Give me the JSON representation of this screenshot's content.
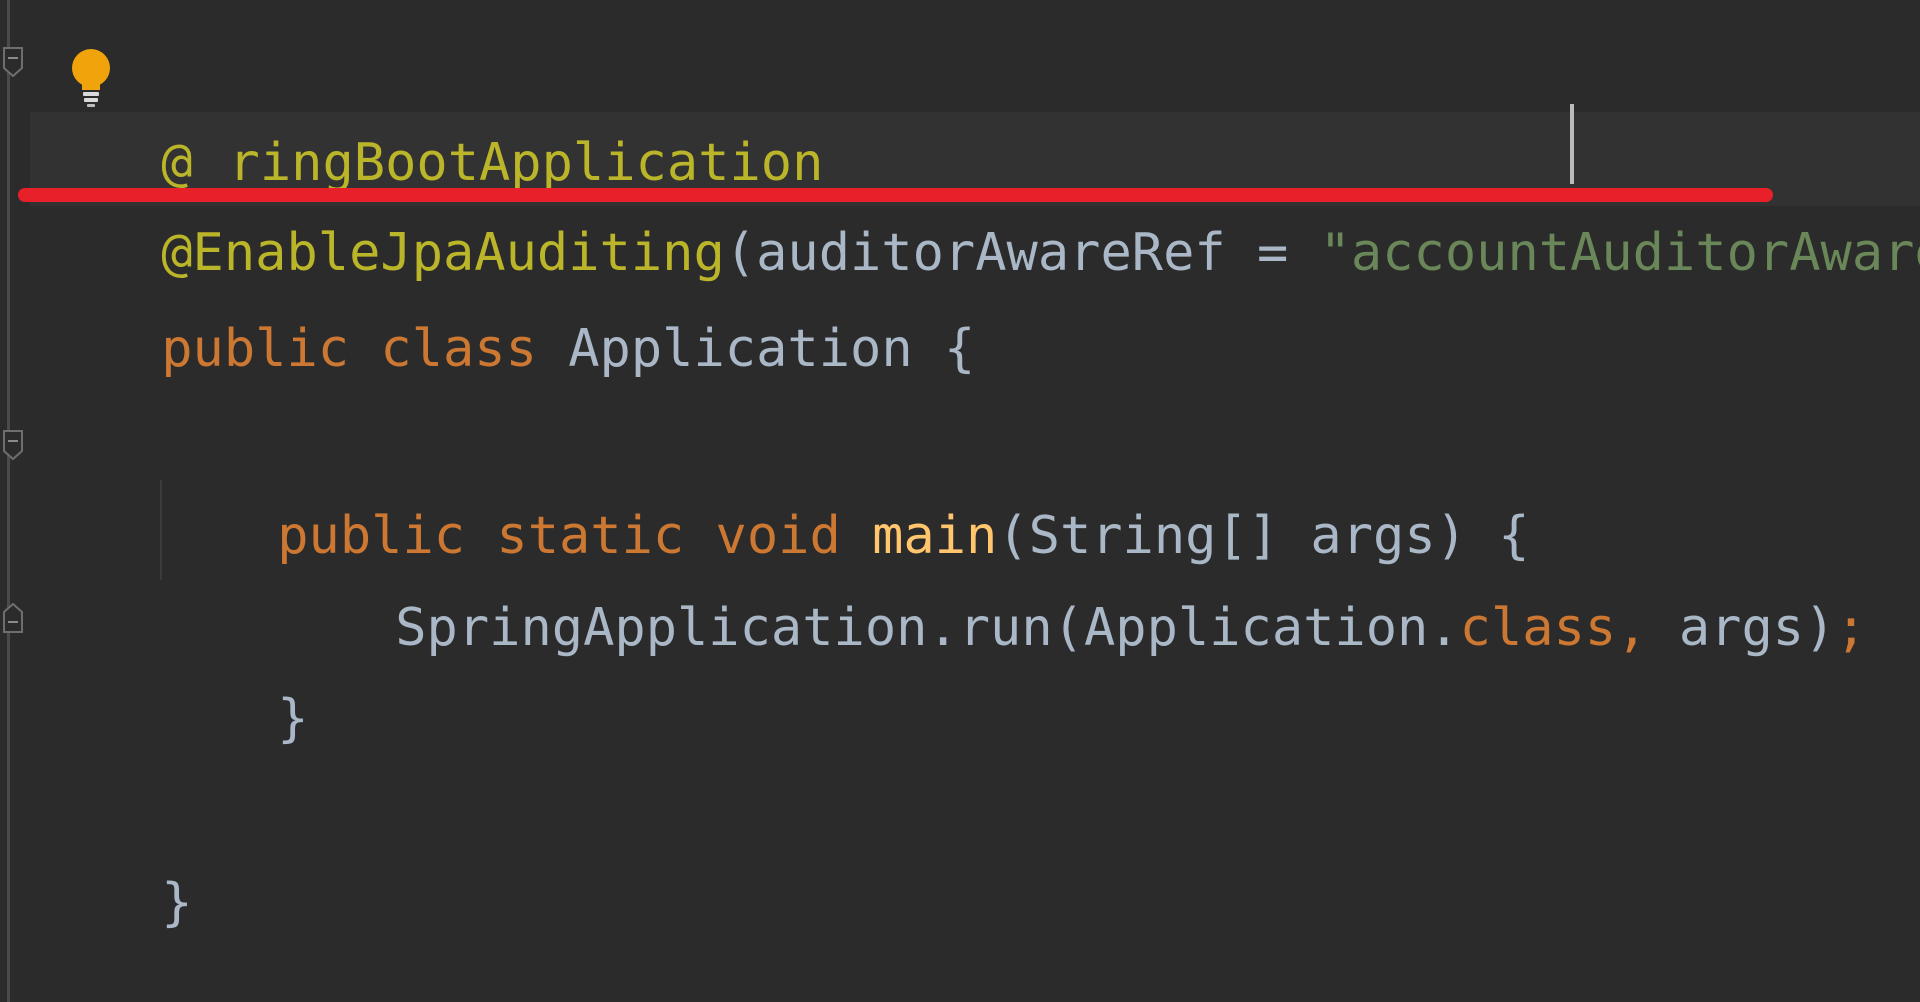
{
  "editor": {
    "language": "java",
    "lines": {
      "l1": {
        "at": "@",
        "annotation_tail": "ringBootApplication"
      },
      "l2": {
        "annotation": "@EnableJpaAuditing",
        "open_paren": "(",
        "param_name": "auditorAwareRef",
        "equals": " = ",
        "string_value": "\"accountAuditorAware\"",
        "close_paren": ")"
      },
      "l3": {
        "kw_public": "public",
        "kw_class": "class",
        "class_name": "Application",
        "brace": "{"
      },
      "l5": {
        "kw_public": "public",
        "kw_static": "static",
        "kw_void": "void",
        "method_name": "main",
        "signature": "(String[] args) {"
      },
      "l6": {
        "call": "SpringApplication.run(Application.",
        "kw_class": "class",
        "comma": ",",
        "args": " args)",
        "semicolon": ";"
      },
      "l7": {
        "brace": "}"
      },
      "l10": {
        "brace": "}"
      }
    },
    "colors": {
      "background": "#2b2b2b",
      "annotation": "#bbb529",
      "keyword": "#cc7832",
      "string": "#6a8759",
      "method": "#ffc66d",
      "text": "#a9b7c6",
      "highlight_underline": "#e8202a",
      "bulb": "#f0a30a"
    },
    "icons": {
      "intention": "lightbulb-icon",
      "fold": "fold-marker-icon"
    }
  }
}
